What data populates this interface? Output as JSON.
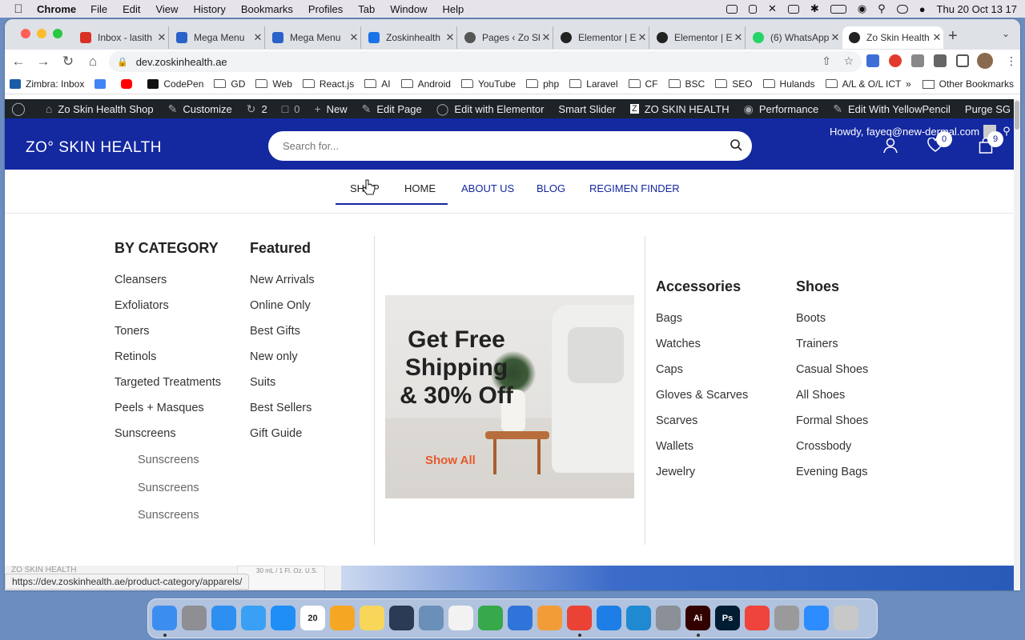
{
  "menubar": {
    "app": "Chrome",
    "items": [
      "File",
      "Edit",
      "View",
      "History",
      "Bookmarks",
      "Profiles",
      "Tab",
      "Window",
      "Help"
    ],
    "clock": "Thu 20 Oct  13 17"
  },
  "tabs": [
    {
      "title": "Inbox - lasith",
      "color": "#d93025"
    },
    {
      "title": "Mega Menu",
      "color": "#2a62c9"
    },
    {
      "title": "Mega Menu",
      "color": "#2a62c9"
    },
    {
      "title": "Zoskinhealth",
      "color": "#1a73e8"
    },
    {
      "title": "Pages ‹ Zo Skin",
      "color": "#555555"
    },
    {
      "title": "Elementor | Edit",
      "color": "#222222"
    },
    {
      "title": "Elementor | Edit",
      "color": "#222222"
    },
    {
      "title": "(6) WhatsApp",
      "color": "#25d366"
    },
    {
      "title": "Zo Skin Health",
      "color": "#222222"
    }
  ],
  "omnibox": {
    "url": "dev.zoskinhealth.ae"
  },
  "bookmarks": {
    "items": [
      {
        "label": "Zimbra: Inbox",
        "type": "site",
        "color": "#1a5ca8"
      },
      {
        "label": "",
        "type": "site",
        "color": "#4285f4"
      },
      {
        "label": "",
        "type": "site",
        "color": "#ff0000"
      },
      {
        "label": "CodePen",
        "type": "site",
        "color": "#111111"
      },
      {
        "label": "GD",
        "type": "folder"
      },
      {
        "label": "Web",
        "type": "folder"
      },
      {
        "label": "React.js",
        "type": "folder"
      },
      {
        "label": "AI",
        "type": "folder"
      },
      {
        "label": "Android",
        "type": "folder"
      },
      {
        "label": "YouTube",
        "type": "folder"
      },
      {
        "label": "php",
        "type": "folder"
      },
      {
        "label": "Laravel",
        "type": "folder"
      },
      {
        "label": "CF",
        "type": "folder"
      },
      {
        "label": "BSC",
        "type": "folder"
      },
      {
        "label": "SEO",
        "type": "folder"
      },
      {
        "label": "Hulands",
        "type": "folder"
      },
      {
        "label": "A/L & O/L ICT",
        "type": "folder"
      }
    ],
    "more": "»",
    "other": "Other Bookmarks"
  },
  "adminbar": {
    "site": "Zo Skin Health Shop",
    "customize": "Customize",
    "updates": "2",
    "comments": "0",
    "new": "New",
    "edit_page": "Edit Page",
    "elementor": "Edit with Elementor",
    "smart_slider": "Smart Slider",
    "zo": "ZO SKIN HEALTH",
    "performance": "Performance",
    "yellowpencil": "Edit With YellowPencil",
    "purge": "Purge SG Cache"
  },
  "header": {
    "logo": "ZO° SKIN HEALTH",
    "search_placeholder": "Search for...",
    "howdy": "Howdy, fayeq@new-dermal.com",
    "wishlist_count": "0",
    "cart_count": "9"
  },
  "nav": {
    "items": [
      "SHOP",
      "HOME",
      "ABOUT US",
      "BLOG",
      "REGIMEN FINDER"
    ]
  },
  "mega": {
    "category": {
      "title": "BY CATEGORY",
      "links": [
        "Cleansers",
        "Exfoliators",
        "Toners",
        "Retinols",
        "Targeted Treatments",
        "Peels + Masques",
        "Sunscreens"
      ],
      "sublinks": [
        "Sunscreens",
        "Sunscreens",
        "Sunscreens"
      ]
    },
    "featured": {
      "title": "Featured",
      "links": [
        "New Arrivals",
        "Online Only",
        "Best Gifts",
        "New only",
        "Suits",
        "Best Sellers",
        "Gift Guide"
      ]
    },
    "promo": {
      "title": "Get Free Shipping & 30% Off",
      "cta": "Show All"
    },
    "accessories": {
      "title": "Accessories",
      "links": [
        "Bags",
        "Watches",
        "Caps",
        "Gloves & Scarves",
        "Scarves",
        "Wallets",
        "Jewelry"
      ]
    },
    "shoes": {
      "title": "Shoes",
      "links": [
        "Boots",
        "Trainers",
        "Casual Shoes",
        "All Shoes",
        "Formal Shoes",
        "Crossbody",
        "Evening Bags"
      ]
    }
  },
  "hero": {
    "bottle_text": "30 mL / 1 Fl. Oz. U.S.",
    "logo_text": "ZO SKIN HEALTH"
  },
  "status_url": "https://dev.zoskinhealth.ae/product-category/apparels/",
  "dock": {
    "apps": [
      {
        "name": "finder-icon",
        "color": "#3b8ef0",
        "label": ""
      },
      {
        "name": "launchpad-icon",
        "color": "#8e8e93",
        "label": ""
      },
      {
        "name": "safari-icon",
        "color": "#2d8ff0",
        "label": ""
      },
      {
        "name": "mail-icon",
        "color": "#3aa0f5",
        "label": ""
      },
      {
        "name": "app-store-icon",
        "color": "#1f8ef7",
        "label": ""
      },
      {
        "name": "calendar-icon",
        "color": "#ffffff",
        "label": "20"
      },
      {
        "name": "photos-icon",
        "color": "#f5a623",
        "label": ""
      },
      {
        "name": "notes-icon",
        "color": "#f7d65a",
        "label": ""
      },
      {
        "name": "quicktime-icon",
        "color": "#2b3a55",
        "label": ""
      },
      {
        "name": "preview-icon",
        "color": "#6a8fb8",
        "label": ""
      },
      {
        "name": "reminders-icon",
        "color": "#f2f2f2",
        "label": ""
      },
      {
        "name": "numbers-icon",
        "color": "#37a94a",
        "label": ""
      },
      {
        "name": "keynote-icon",
        "color": "#2f74d8",
        "label": ""
      },
      {
        "name": "pages-icon",
        "color": "#f29c38",
        "label": ""
      },
      {
        "name": "chrome-icon",
        "color": "#ea4335",
        "label": ""
      },
      {
        "name": "xcode-icon",
        "color": "#1c7ee6",
        "label": ""
      },
      {
        "name": "vscode-icon",
        "color": "#1f8ad2",
        "label": ""
      },
      {
        "name": "system-preferences-icon",
        "color": "#8a8f98",
        "label": ""
      },
      {
        "name": "illustrator-icon",
        "color": "#330000",
        "label": "Ai"
      },
      {
        "name": "photoshop-icon",
        "color": "#001d34",
        "label": "Ps"
      },
      {
        "name": "anydesk-icon",
        "color": "#ef443b",
        "label": ""
      },
      {
        "name": "font-book-icon",
        "color": "#9a9a9a",
        "label": ""
      },
      {
        "name": "zoom-icon",
        "color": "#2d8cff",
        "label": ""
      },
      {
        "name": "trash-icon",
        "color": "#c8c8c8",
        "label": ""
      }
    ]
  }
}
